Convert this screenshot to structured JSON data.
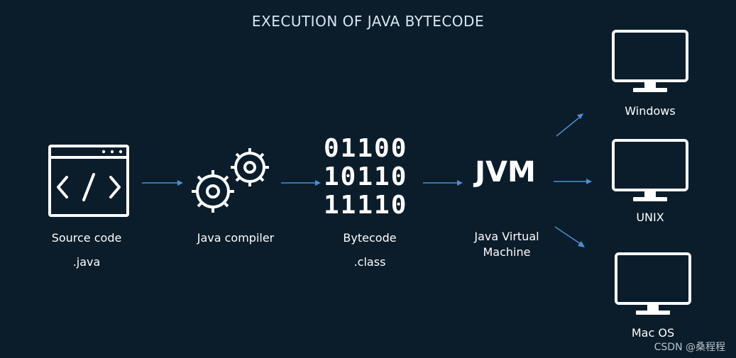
{
  "title": "EXECUTION OF JAVA BYTECODE",
  "source": {
    "label": "Source code",
    "ext": ".java",
    "icon": "code-window-icon"
  },
  "compiler": {
    "label": "Java compiler",
    "icon": "gears-icon"
  },
  "bytecode": {
    "label": "Bytecode",
    "ext": ".class",
    "lines": [
      "01100",
      "10110",
      "11110"
    ]
  },
  "jvm": {
    "title": "JVM",
    "desc_line1": "Java Virtual",
    "desc_line2": "Machine"
  },
  "targets": [
    {
      "label": "Windows",
      "icon": "monitor-icon"
    },
    {
      "label": "UNIX",
      "icon": "monitor-icon"
    },
    {
      "label": "Mac OS",
      "icon": "monitor-icon"
    }
  ],
  "watermark": "CSDN @桑程程",
  "colors": {
    "background": "#0b1d2b",
    "foreground": "#ffffff",
    "arrow": "#4c8ed1"
  }
}
